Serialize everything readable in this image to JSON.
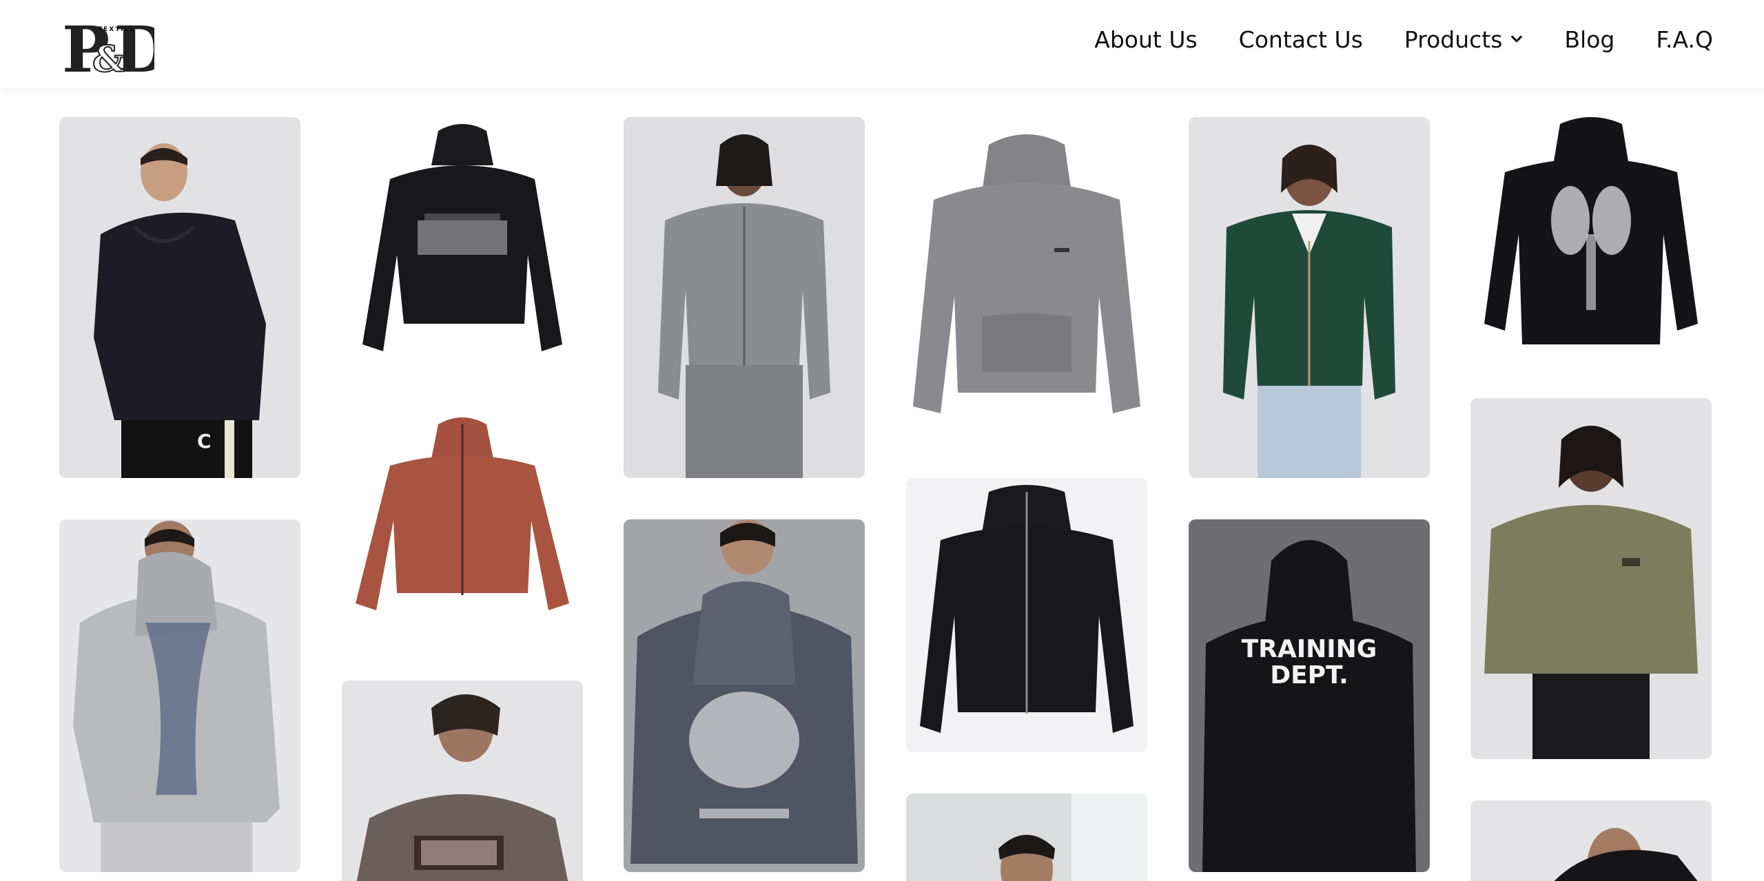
{
  "brand": {
    "name": "P&D",
    "tagline": "TEXTILE"
  },
  "nav": {
    "about": "About Us",
    "contact": "Contact Us",
    "products": "Products",
    "blog": "Blog",
    "faq": "F.A.Q"
  },
  "gallery": {
    "print_text_training": "TRAINING",
    "print_text_dept": "DEPT.",
    "print_text_c": "C"
  },
  "colors": {
    "black_hoodie": "#1c1c22",
    "grey_hoodie": "#8a8a8e",
    "green_hoodie": "#1f4a3a",
    "rust_hoodie": "#a85440",
    "olive_hoodie": "#7b7d5c",
    "blue_grey_hoodie": "#4f5562",
    "brown_hoodie": "#6c5f5a",
    "light_grey_hoodie": "#b6b8bb"
  }
}
